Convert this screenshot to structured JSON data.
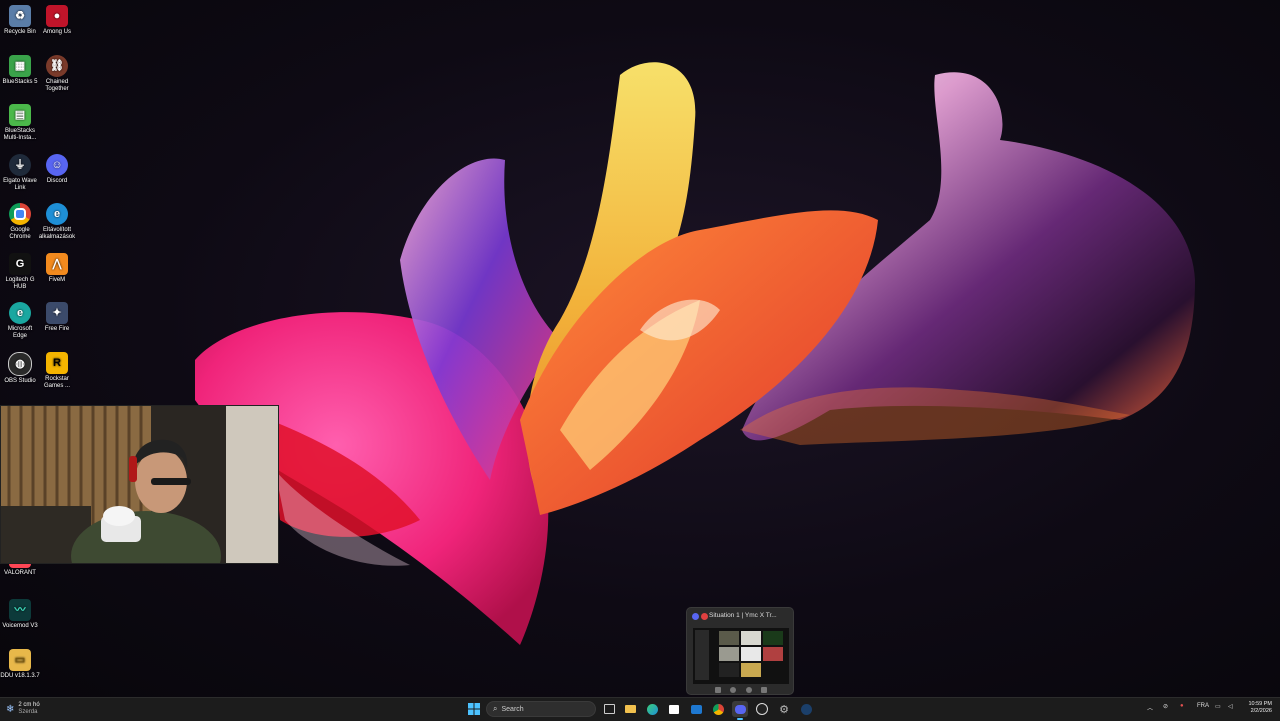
{
  "desktop_icons": [
    {
      "label": "Recycle Bin",
      "icon": "recycle-bin-icon",
      "color": "#5a7da8"
    },
    {
      "label": "Among Us",
      "icon": "among-us-icon",
      "color": "#c0142a"
    },
    {
      "label": "BlueStacks 5",
      "icon": "bluestacks-icon",
      "color": "#3aa34a"
    },
    {
      "label": "Chained Together",
      "icon": "chained-together-icon",
      "color": "#7a3a2a"
    },
    {
      "label": "BlueStacks Multi-Insta...",
      "icon": "bluestacks-multi-icon",
      "color": "#4bb84a"
    },
    {
      "label": "Elgato Wave Link",
      "icon": "elgato-icon",
      "color": "#1f2a3a"
    },
    {
      "label": "Discord",
      "icon": "discord-icon",
      "color": "#5865f2"
    },
    {
      "label": "Google Chrome",
      "icon": "chrome-icon",
      "color": "#db4437"
    },
    {
      "label": "Eltávolított alkalmazások",
      "icon": "edge-icon",
      "color": "#1e8fd6"
    },
    {
      "label": "Logitech G HUB",
      "icon": "logitech-icon",
      "color": "#111111"
    },
    {
      "label": "FiveM",
      "icon": "fivem-icon",
      "color": "#f28a1e"
    },
    {
      "label": "Microsoft Edge",
      "icon": "edge-icon",
      "color": "#1aa7a0"
    },
    {
      "label": "Free Fire",
      "icon": "free-fire-icon",
      "color": "#3b4a6a"
    },
    {
      "label": "OBS Studio",
      "icon": "obs-icon",
      "color": "#2a2a2a"
    },
    {
      "label": "Rockstar Games ...",
      "icon": "rockstar-icon",
      "color": "#f4b400"
    },
    {
      "label": "VALORANT",
      "icon": "valorant-icon",
      "color": "#ff4655"
    },
    {
      "label": "Voicemod V3",
      "icon": "voicemod-icon",
      "color": "#0d3a3a"
    },
    {
      "label": "DDU v18.1.3.7",
      "icon": "folder-icon",
      "color": "#e8b84a"
    }
  ],
  "taskbar": {
    "weather": {
      "temp": "2 cm hó",
      "desc": "Szerda"
    },
    "search_placeholder": "Search",
    "apps": [
      "start-icon",
      "task-view-icon",
      "file-explorer-icon",
      "edge-icon",
      "store-icon",
      "mail-icon",
      "chrome-icon",
      "discord-icon",
      "obs-icon",
      "settings-icon",
      "steam-icon"
    ],
    "language": "FRA",
    "time": "10:59 PM",
    "date": "2/2/2026"
  },
  "preview": {
    "title": "Situation 1 | Ymc X Tr..."
  }
}
